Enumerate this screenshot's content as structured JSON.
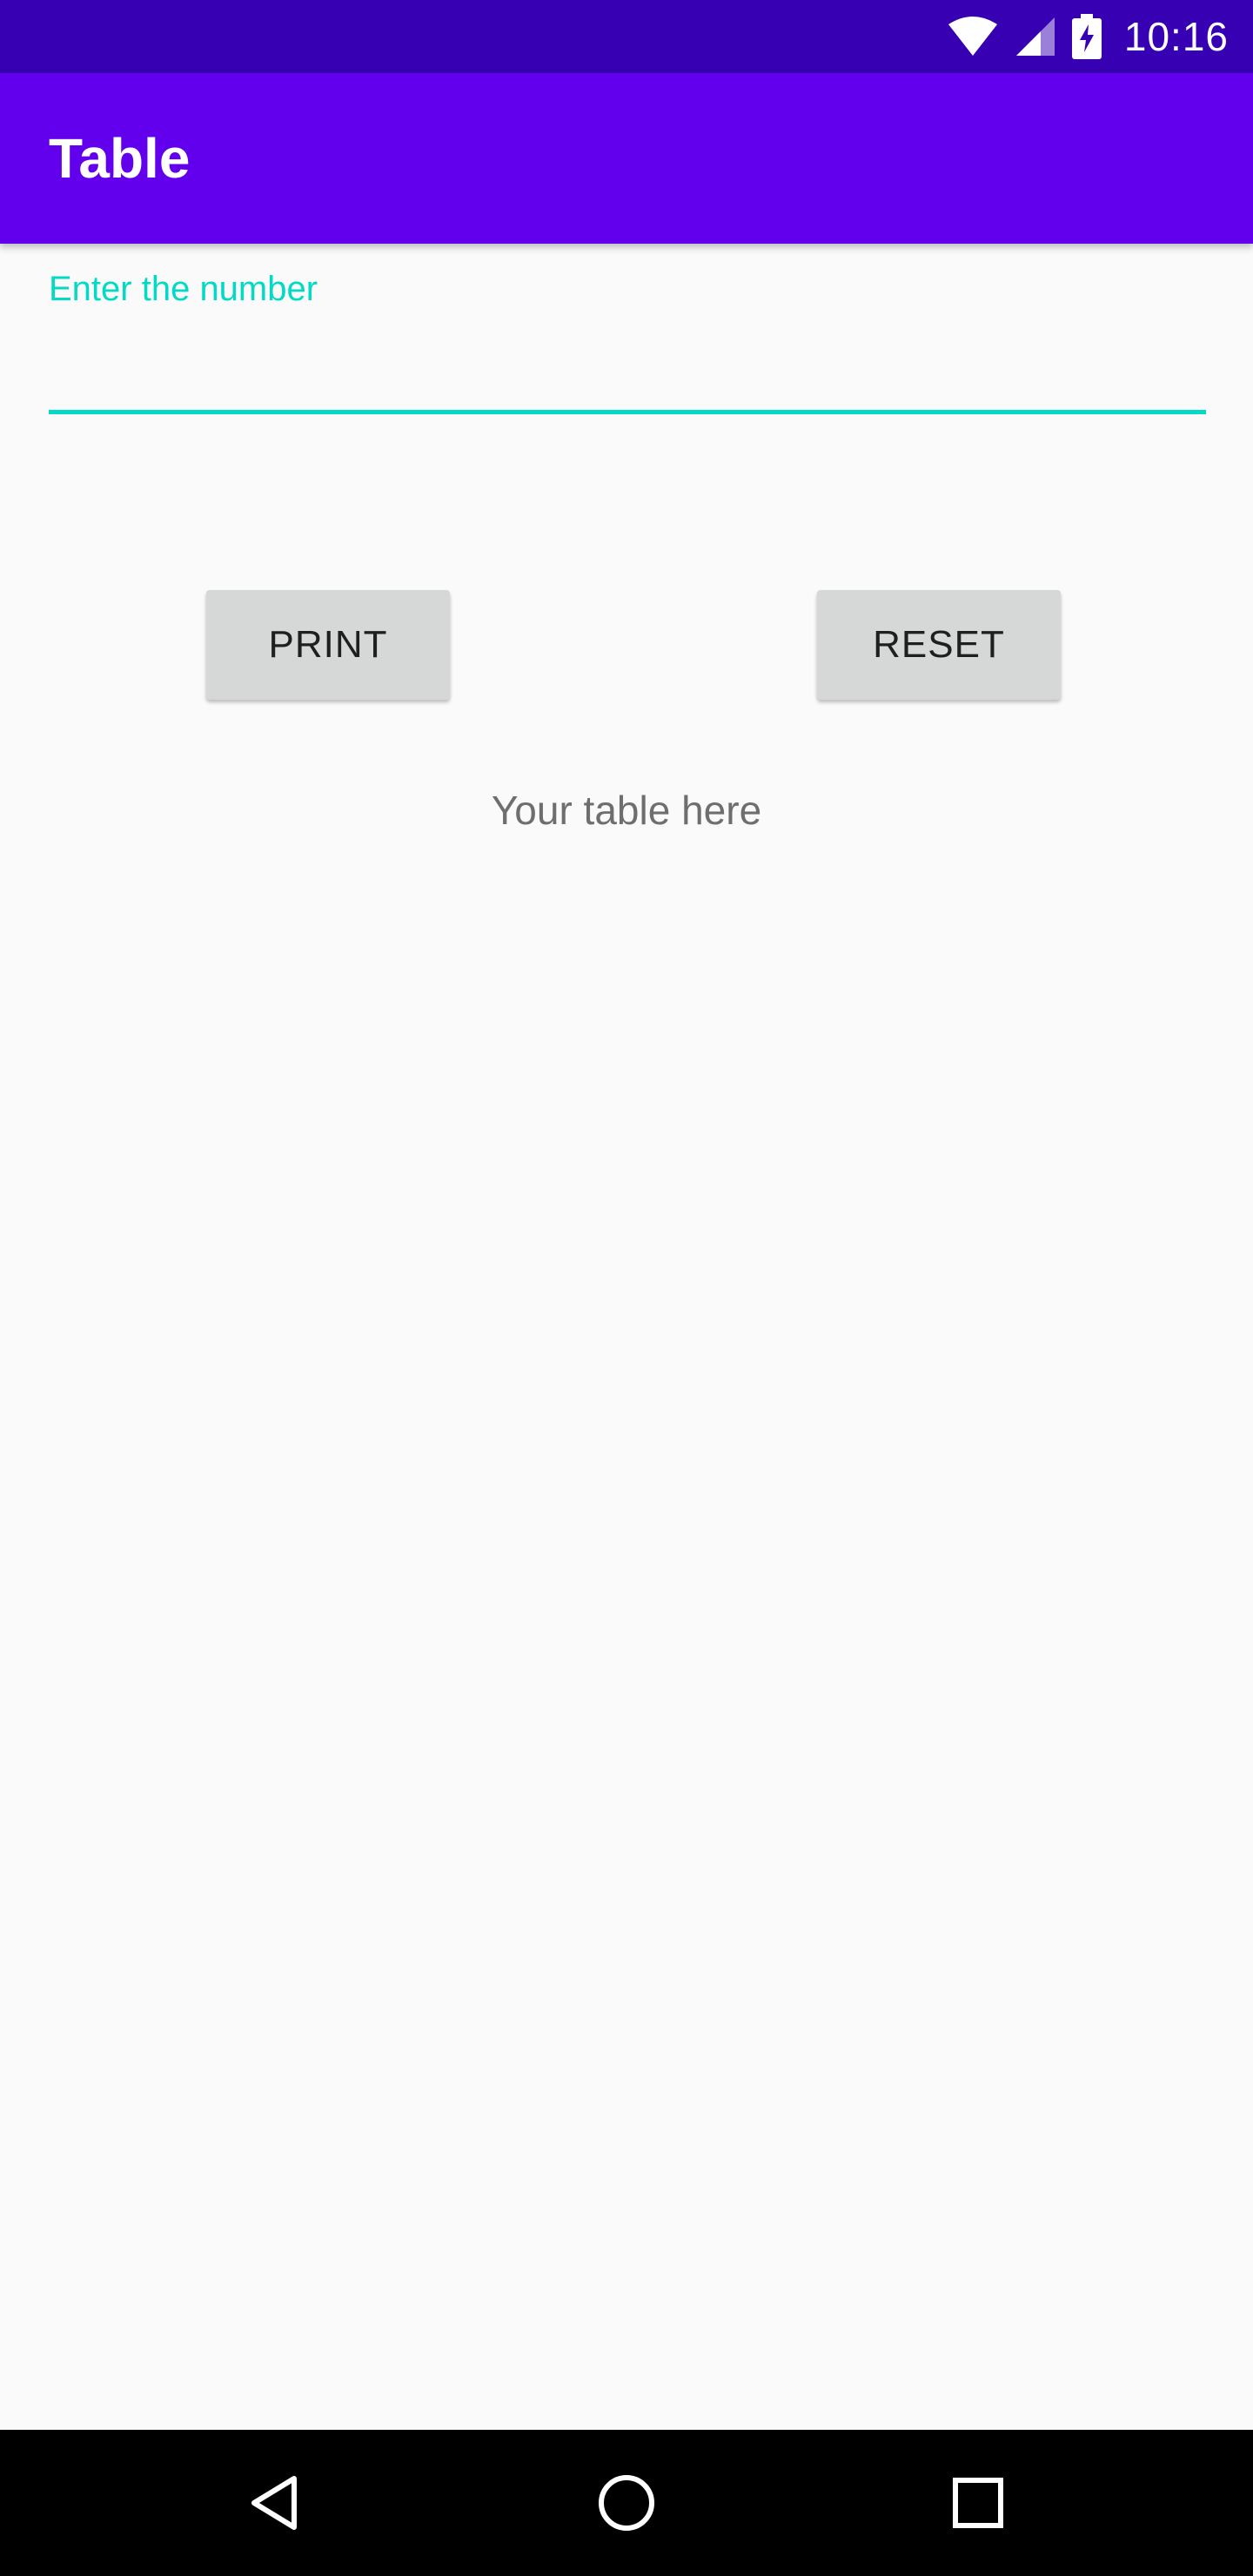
{
  "status_bar": {
    "time": "10:16",
    "icons": [
      "wifi-icon",
      "cell-signal-icon",
      "battery-charging-icon"
    ]
  },
  "app_bar": {
    "title": "Table"
  },
  "input": {
    "label": "Enter the number",
    "value": "",
    "placeholder": "Enter the number"
  },
  "buttons": {
    "print_label": "PRINT",
    "reset_label": "RESET"
  },
  "output": {
    "text": "Your table here"
  },
  "nav_bar": {
    "icons": [
      "back-icon",
      "home-icon",
      "recents-icon"
    ]
  },
  "colors": {
    "status_bar": "#3700B3",
    "app_bar": "#6200EE",
    "accent": "#03DAC5",
    "button_bg": "#D6D7D7",
    "background": "#FAFAFA"
  }
}
